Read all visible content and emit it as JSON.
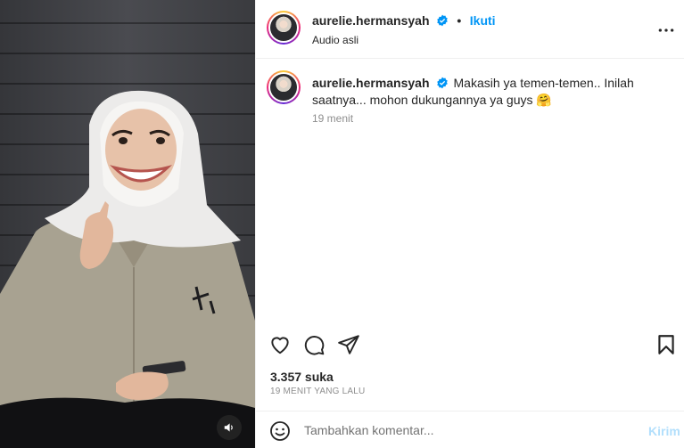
{
  "post": {
    "username": "aurelie.hermansyah",
    "separator": "•",
    "follow_label": "Ikuti",
    "audio_label": "Audio asli"
  },
  "caption": {
    "username": "aurelie.hermansyah",
    "text": "Makasih ya temen-temen.. Inilah saatnya... mohon dukungannya ya guys 🤗",
    "time": "19 menit"
  },
  "engagement": {
    "likes": "3.357 suka",
    "time_ago": "19 MENIT YANG LALU"
  },
  "comment": {
    "placeholder": "Tambahkan komentar...",
    "post_label": "Kirim"
  },
  "icons": {
    "verified": "verified-badge-icon",
    "more": "more-options-icon",
    "like": "heart-icon",
    "comment": "comment-icon",
    "share": "share-icon",
    "save": "bookmark-icon",
    "emoji": "emoji-icon",
    "mute": "volume-icon"
  },
  "colors": {
    "accent": "#0095f6",
    "verified": "#0095f6",
    "post_disabled": "#b2dffc",
    "muted_text": "#8e8e8e"
  }
}
